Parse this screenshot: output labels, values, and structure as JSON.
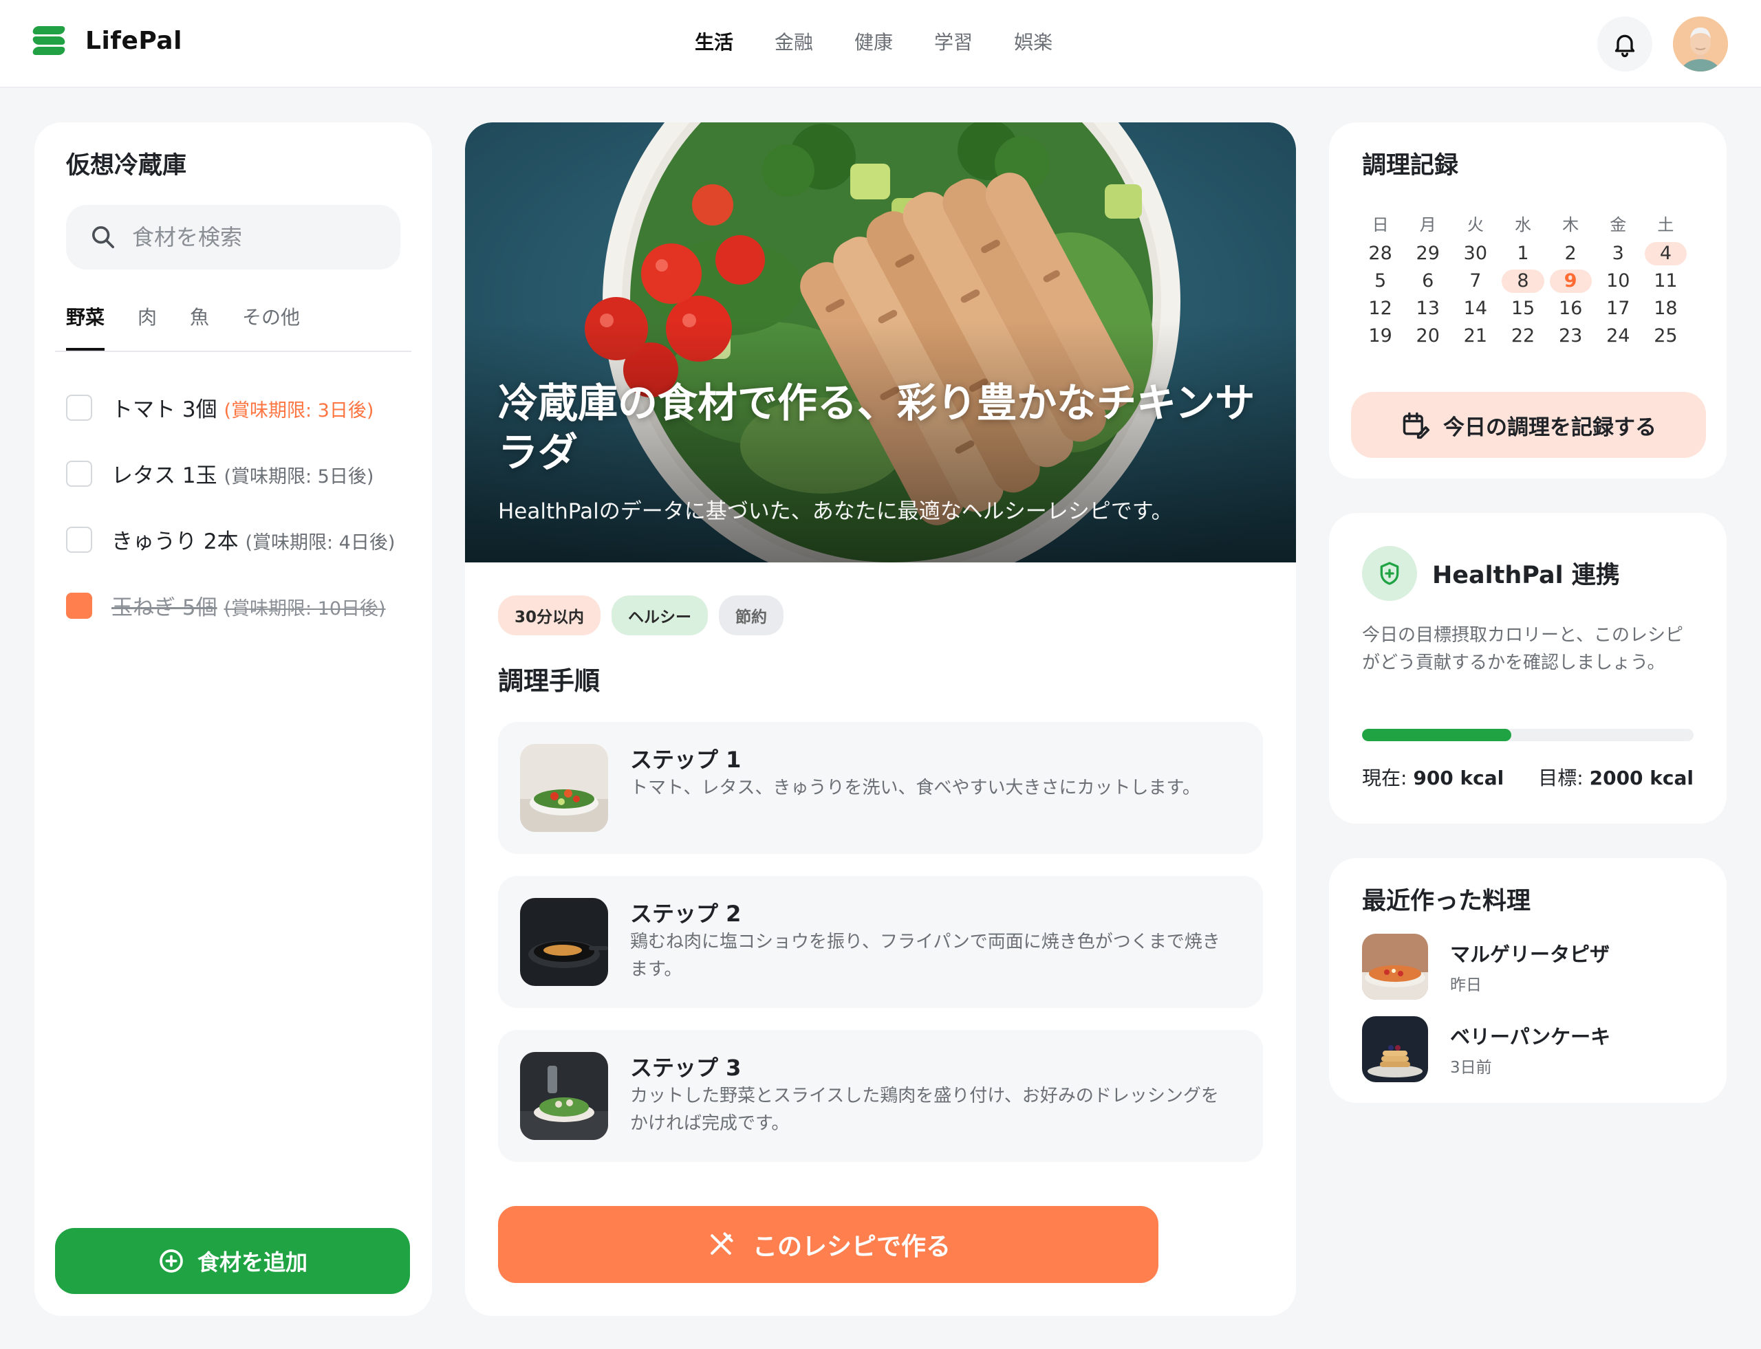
{
  "app": {
    "name": "LifePal"
  },
  "nav": {
    "items": [
      "生活",
      "金融",
      "健康",
      "学習",
      "娯楽"
    ],
    "active_index": 0
  },
  "fridge": {
    "title": "仮想冷蔵庫",
    "search_placeholder": "食材を検索",
    "tabs": [
      "野菜",
      "肉",
      "魚",
      "その他"
    ],
    "active_tab": 0,
    "items": [
      {
        "label": "トマト 3個",
        "expiry": "(賞味期限: 3日後)",
        "warning": true,
        "checked": false
      },
      {
        "label": "レタス 1玉",
        "expiry": "(賞味期限: 5日後)",
        "warning": false,
        "checked": false
      },
      {
        "label": "きゅうり 2本",
        "expiry": "(賞味期限: 4日後)",
        "warning": false,
        "checked": false
      },
      {
        "label": "玉ねぎ 5個",
        "expiry": "(賞味期限: 10日後)",
        "warning": false,
        "checked": true
      }
    ],
    "add_button": "食材を追加"
  },
  "recipe": {
    "title": "冷蔵庫の食材で作る、彩り豊かなチキンサラダ",
    "subtitle": "HealthPalのデータに基づいた、あなたに最適なヘルシーレシピです。",
    "tags": [
      "30分以内",
      "ヘルシー",
      "節約"
    ],
    "steps_heading": "調理手順",
    "steps": [
      {
        "title": "ステップ 1",
        "desc": "トマト、レタス、きゅうりを洗い、食べやすい大きさにカットします。"
      },
      {
        "title": "ステップ 2",
        "desc": "鶏むね肉に塩コショウを振り、フライパンで両面に焼き色がつくまで焼きます。"
      },
      {
        "title": "ステップ 3",
        "desc": "カットした野菜とスライスした鶏肉を盛り付け、お好みのドレッシングをかければ完成です。"
      }
    ],
    "cook_button": "このレシピで作る"
  },
  "calendar": {
    "title": "調理記録",
    "weekdays": [
      "日",
      "月",
      "火",
      "水",
      "木",
      "金",
      "土"
    ],
    "weeks": [
      [
        "28",
        "29",
        "30",
        "1",
        "2",
        "3",
        "4"
      ],
      [
        "5",
        "6",
        "7",
        "8",
        "9",
        "10",
        "11"
      ],
      [
        "12",
        "13",
        "14",
        "15",
        "16",
        "17",
        "18"
      ],
      [
        "19",
        "20",
        "21",
        "22",
        "23",
        "24",
        "25"
      ]
    ],
    "marked_days": [
      "4",
      "8"
    ],
    "today": "9",
    "record_button": "今日の調理を記録する"
  },
  "healthpal": {
    "title": "HealthPal 連携",
    "desc": "今日の目標摂取カロリーと、このレシピがどう貢献するかを確認しましょう。",
    "current_label": "現在:",
    "current_value": "900 kcal",
    "goal_label": "目標:",
    "goal_value": "2000 kcal",
    "progress": 0.45
  },
  "recent": {
    "title": "最近作った料理",
    "items": [
      {
        "name": "マルゲリータピザ",
        "when": "昨日"
      },
      {
        "name": "ベリーパンケーキ",
        "when": "3日前"
      }
    ]
  },
  "colors": {
    "green": "#1fa343",
    "orange": "#ff7f4e",
    "peach": "#fde3d9"
  }
}
